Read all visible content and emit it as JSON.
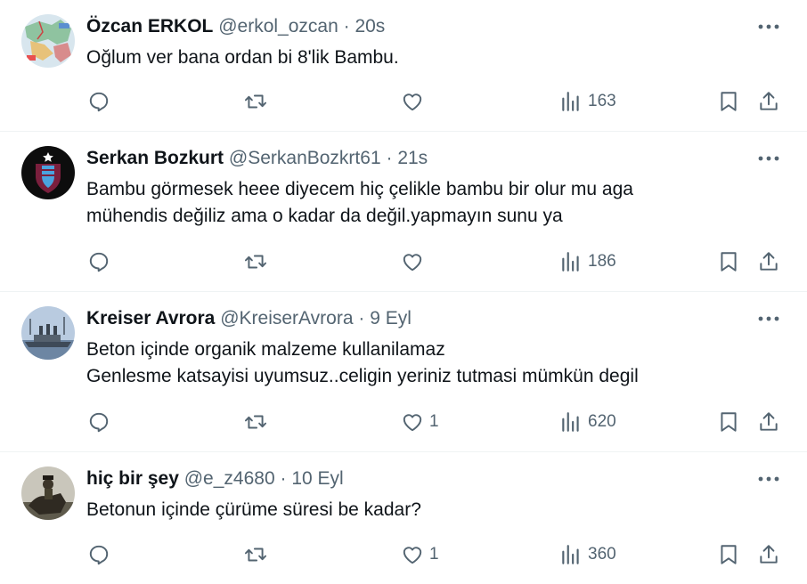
{
  "tweets": [
    {
      "name": "Özcan ERKOL",
      "handle": "@erkol_ozcan",
      "separator": "·",
      "time": "20s",
      "lines": [
        "Oğlum ver bana ordan bi 8'lik Bambu."
      ],
      "likes": "",
      "views": "163",
      "avatar": "map-avatar"
    },
    {
      "name": "Serkan Bozkurt",
      "handle": "@SerkanBozkrt61",
      "separator": "·",
      "time": "21s",
      "lines": [
        "Bambu görmesek heee diyecem hiç çelikle bambu bir olur mu aga",
        "mühendis değiliz ama o kadar da değil.yapmayın sunu ya"
      ],
      "likes": "",
      "views": "186",
      "avatar": "trabzonspor-crest-avatar"
    },
    {
      "name": "Kreiser Avrora",
      "handle": "@KreiserAvrora",
      "separator": "·",
      "time": "9 Eyl",
      "lines": [
        "Beton içinde organik malzeme kullanilamaz",
        "Genlesme katsayisi uyumsuz..celigin yeriniz tutmasi mümkün degil"
      ],
      "likes": "1",
      "views": "620",
      "avatar": "cruiser-ship-avatar"
    },
    {
      "name": "hiç bir şey",
      "handle": "@e_z4680",
      "separator": "·",
      "time": "10 Eyl",
      "lines": [
        "Betonun içinde çürüme süresi be kadar?"
      ],
      "likes": "1",
      "views": "360",
      "avatar": "soldier-horse-avatar"
    }
  ],
  "colors": {
    "text": "#0f1419",
    "secondary": "#536471",
    "divider": "#eff3f4"
  }
}
